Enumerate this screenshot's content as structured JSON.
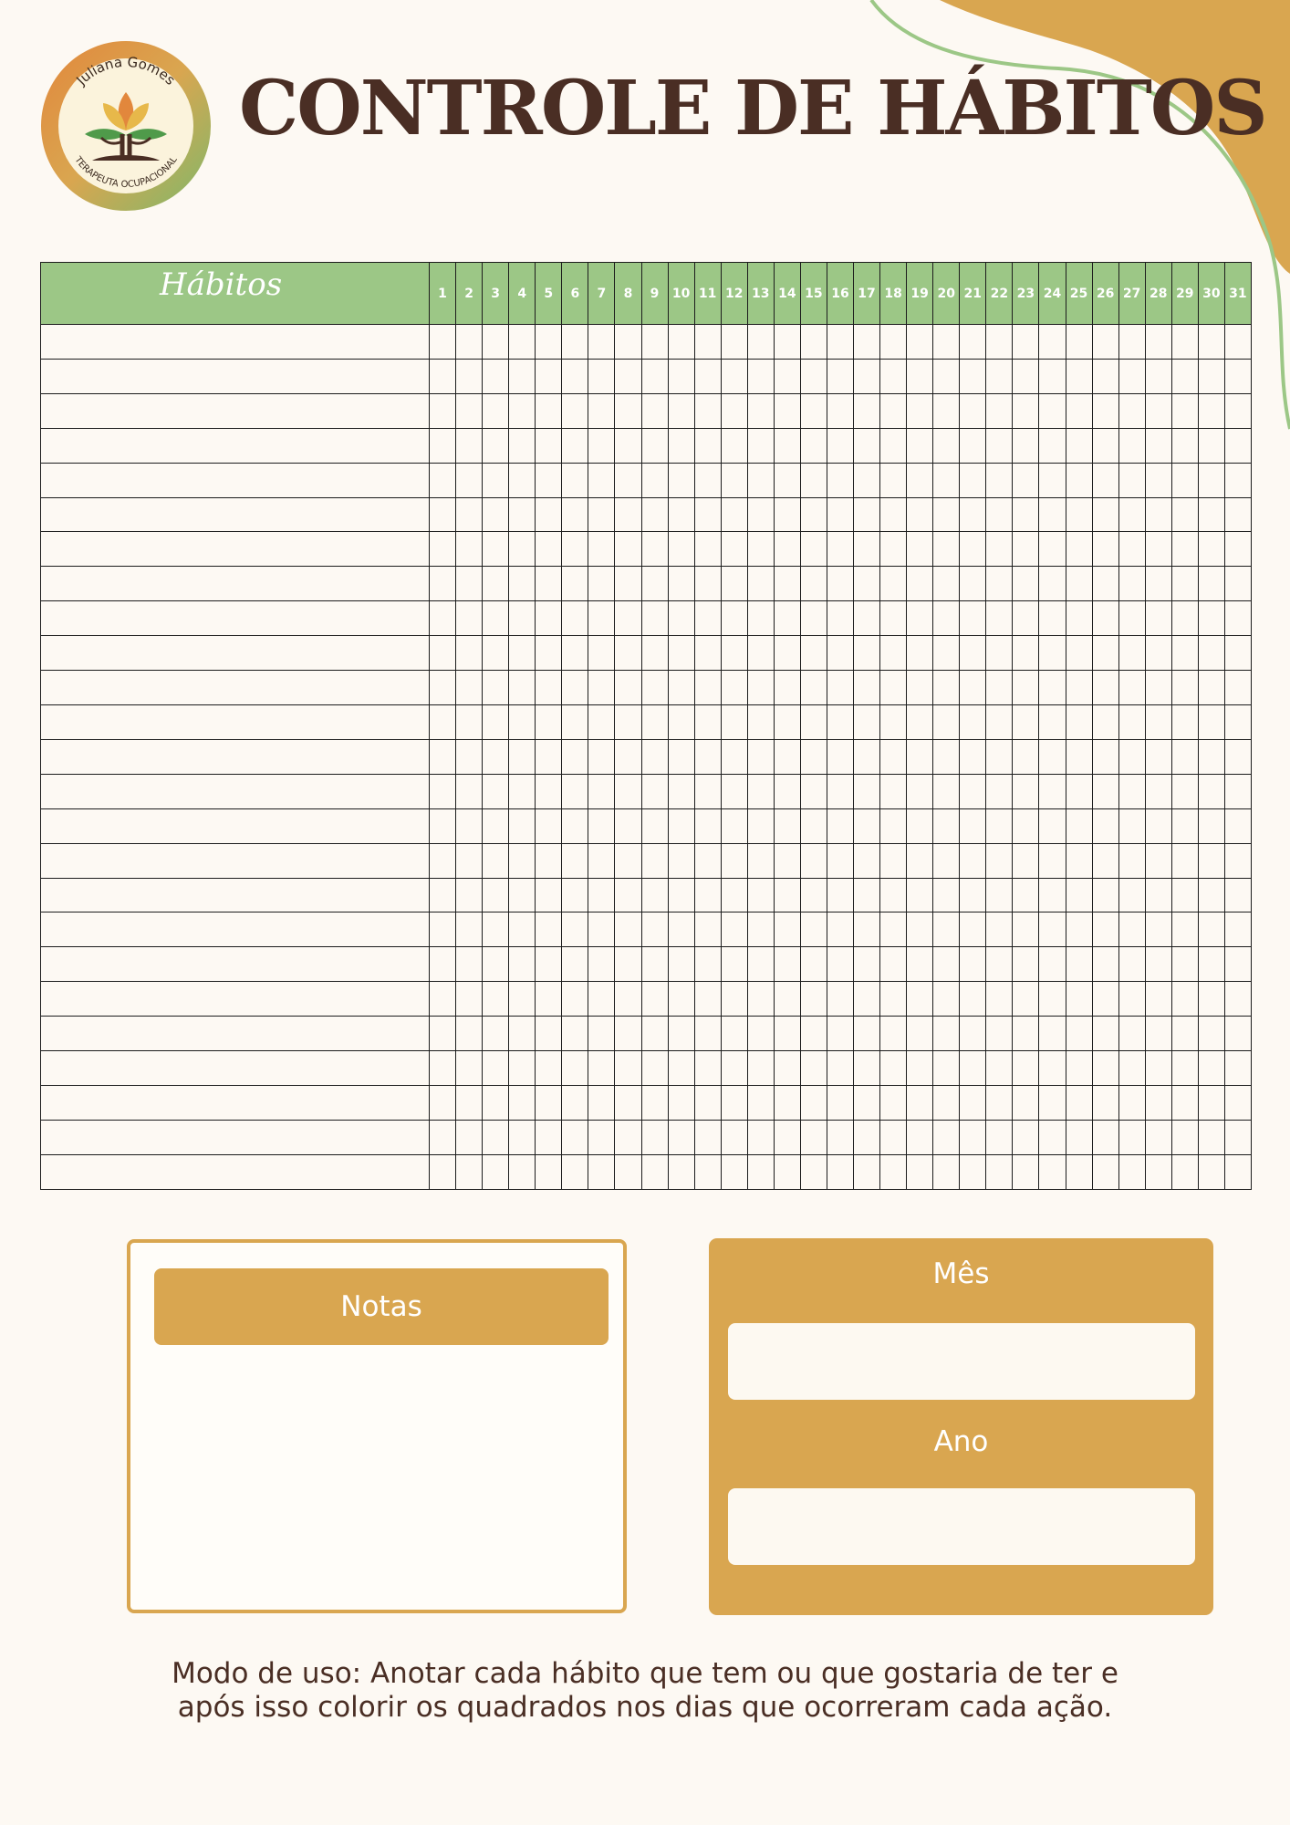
{
  "colors": {
    "background": "#fdf9f3",
    "accent_gold": "#d9a650",
    "accent_green": "#9cc786",
    "text_brown": "#4a2e24"
  },
  "logo": {
    "top_text": "Juliana Gomes",
    "bottom_text": "TERAPEUTA OCUPACIONAL",
    "icon": "lotus-tree-icon"
  },
  "title": "CONTROLE DE HÁBITOS",
  "tracker": {
    "habits_header": "Hábitos",
    "days": [
      "1",
      "2",
      "3",
      "4",
      "5",
      "6",
      "7",
      "8",
      "9",
      "10",
      "11",
      "12",
      "13",
      "14",
      "15",
      "16",
      "17",
      "18",
      "19",
      "20",
      "21",
      "22",
      "23",
      "24",
      "25",
      "26",
      "27",
      "28",
      "29",
      "30",
      "31"
    ],
    "row_count": 25
  },
  "notes": {
    "label": "Notas"
  },
  "date": {
    "month_label": "Mês",
    "year_label": "Ano"
  },
  "usage_note": {
    "line1": "Modo de uso: Anotar cada hábito que tem ou que gostaria de ter e",
    "line2": "após isso colorir os quadrados nos dias que ocorreram cada ação."
  }
}
